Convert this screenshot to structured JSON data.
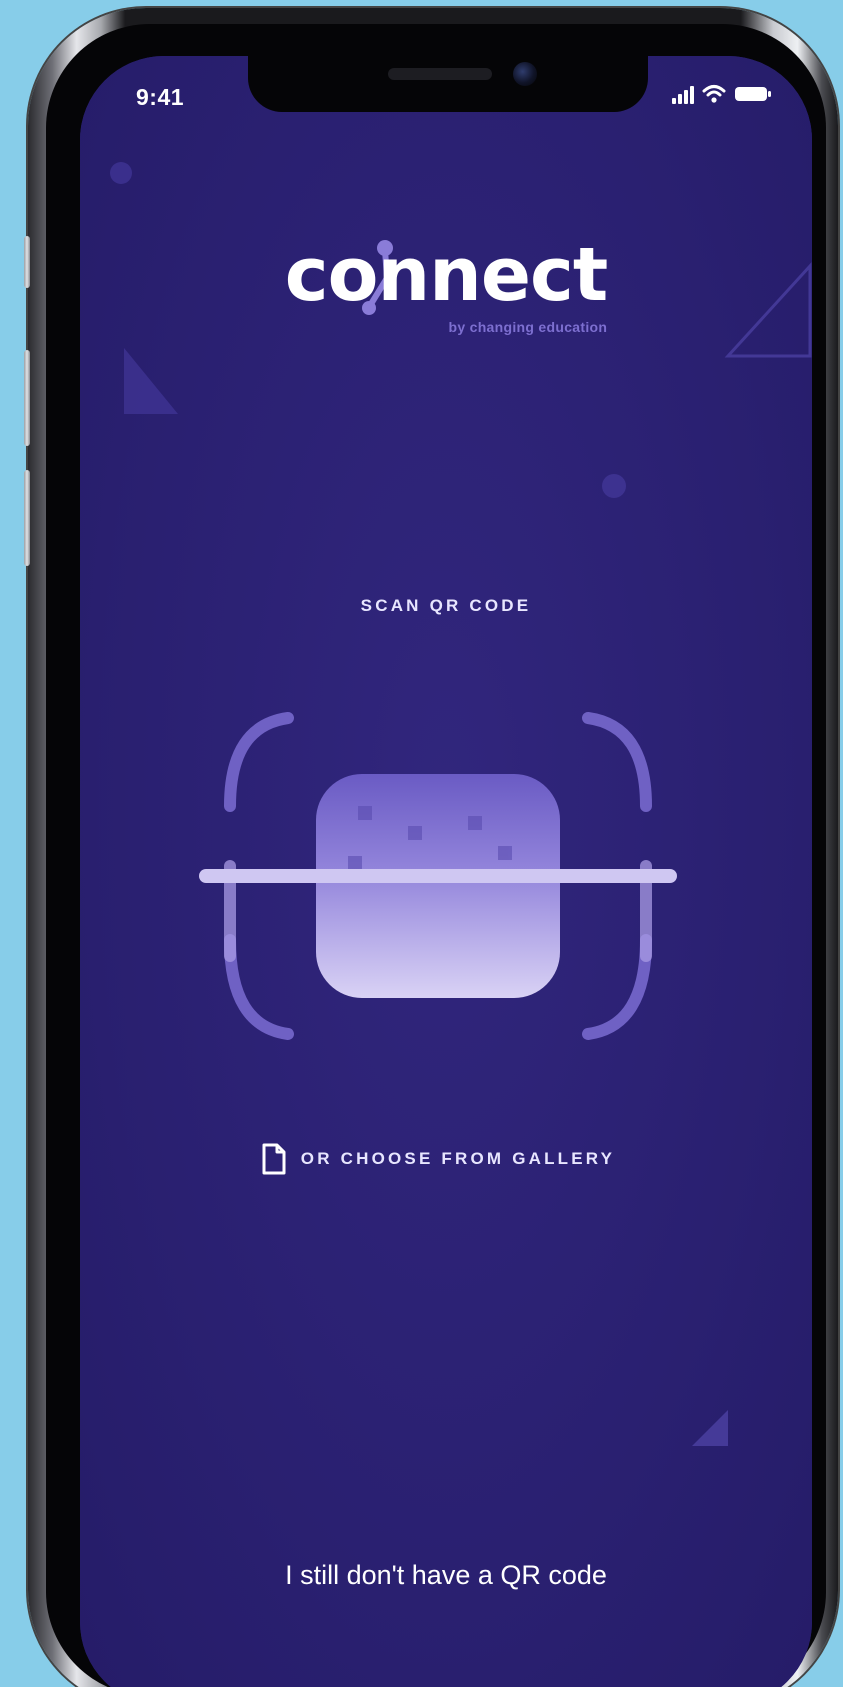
{
  "status_bar": {
    "time": "9:41",
    "icons": [
      "signal-icon",
      "wifi-icon",
      "battery-icon"
    ]
  },
  "logo": {
    "wordmark": "connect",
    "tagline": "by changing education"
  },
  "scan": {
    "title": "SCAN QR CODE",
    "gallery_label": "OR CHOOSE FROM GALLERY",
    "gallery_icon": "document-icon"
  },
  "footer": {
    "no_qr_label": "I still don't have a QR code"
  },
  "colors": {
    "background": "#2b2173",
    "accent": "#8a7cd8",
    "text": "#ffffff",
    "page_background": "#87cde9"
  }
}
